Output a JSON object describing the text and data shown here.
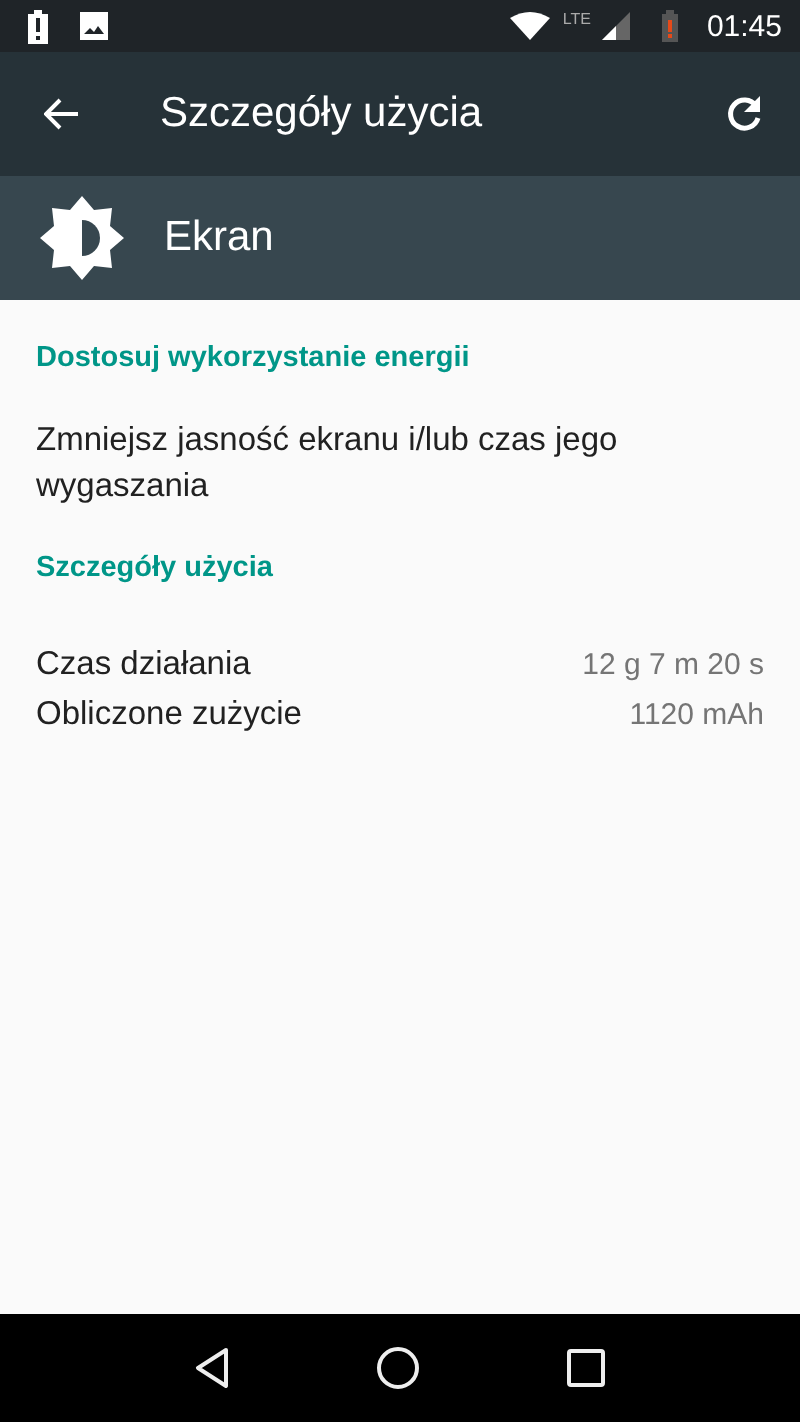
{
  "status_bar": {
    "network": "LTE",
    "time": "01:45"
  },
  "toolbar": {
    "title": "Szczegóły użycia"
  },
  "header": {
    "title": "Ekran"
  },
  "sections": [
    {
      "title": "Dostosuj wykorzystanie energii",
      "items": [
        {
          "kind": "action",
          "text": "Zmniejsz jasność ekranu i/lub czas jego wygaszania"
        }
      ]
    },
    {
      "title": "Szczegóły użycia",
      "items": [
        {
          "kind": "stat",
          "label": "Czas działania",
          "value": "12 g 7 m 20 s"
        },
        {
          "kind": "stat",
          "label": "Obliczone zużycie",
          "value": "1120 mAh"
        }
      ]
    }
  ]
}
